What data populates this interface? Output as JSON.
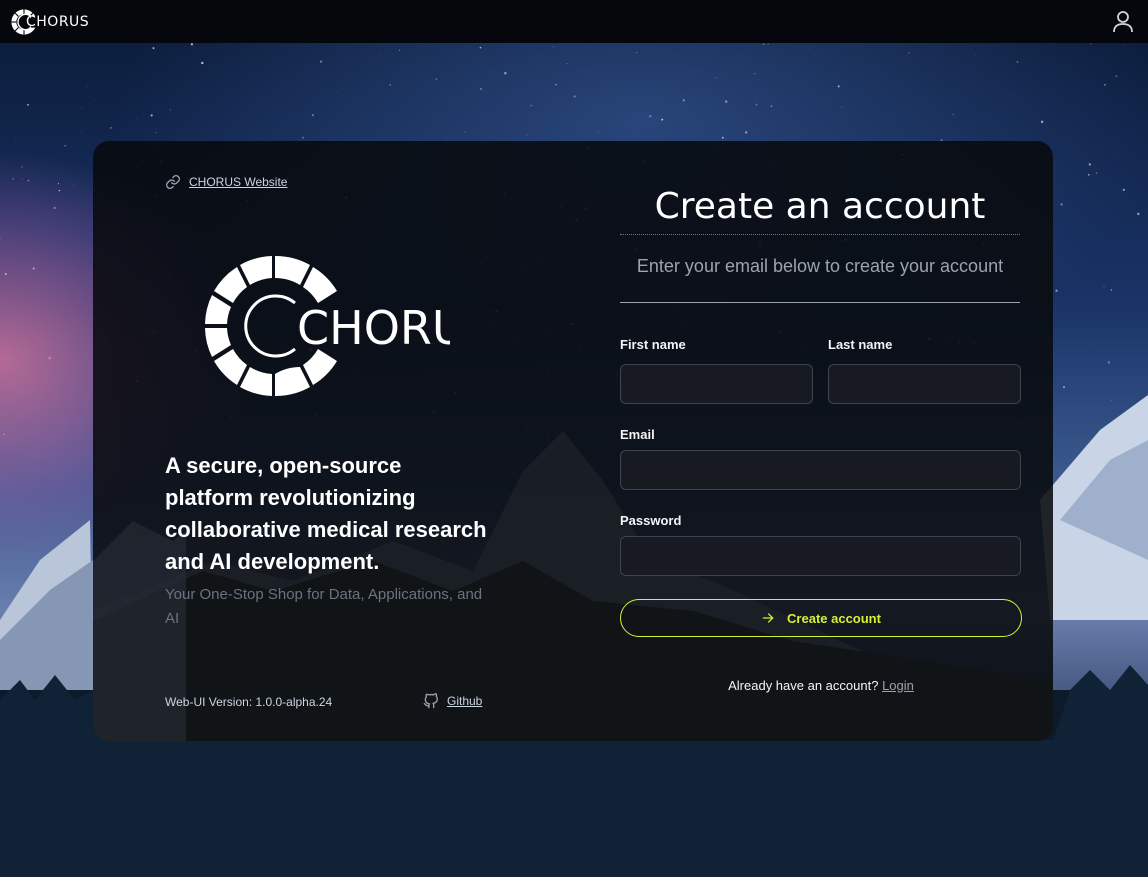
{
  "app": {
    "brand": "CHORUS"
  },
  "left": {
    "website_link": "CHORUS Website",
    "logo_text": "CHORUS",
    "tagline": "A secure, open-source platform revolutionizing collaborative medical research and AI development.",
    "subline": "Your One-Stop Shop for Data, Applications, and AI",
    "version": "Web-UI Version: 1.0.0-alpha.24",
    "github": "Github"
  },
  "form": {
    "title": "Create an account",
    "subtitle": "Enter your email below to create your account",
    "first_name_label": "First name",
    "first_name_value": "",
    "last_name_label": "Last name",
    "last_name_value": "",
    "email_label": "Email",
    "email_value": "",
    "password_label": "Password",
    "password_value": "",
    "submit_label": "Create account",
    "login_prompt": "Already have an account?",
    "login_link": "Login"
  },
  "colors": {
    "accent": "#d4f03a",
    "card_bg": "#0a0c10",
    "input_bg": "#171a20"
  },
  "icons": [
    "link-icon",
    "user-icon",
    "github-icon",
    "arrow-right-icon",
    "chorus-logo-icon"
  ]
}
